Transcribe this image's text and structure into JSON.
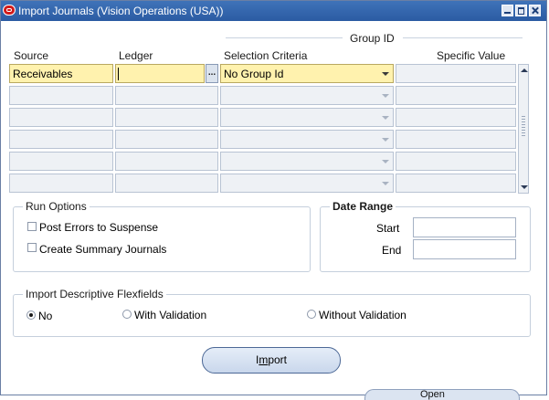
{
  "window": {
    "title": "Import Journals (Vision Operations (USA))"
  },
  "columns": {
    "source": "Source",
    "ledger": "Ledger",
    "group_id": "Group ID",
    "selection": "Selection Criteria",
    "specific": "Specific Value"
  },
  "rows": [
    {
      "source": "Receivables",
      "ledger": "",
      "selection": "No Group Id",
      "specific": ""
    },
    {
      "source": "",
      "ledger": "",
      "selection": "",
      "specific": ""
    },
    {
      "source": "",
      "ledger": "",
      "selection": "",
      "specific": ""
    },
    {
      "source": "",
      "ledger": "",
      "selection": "",
      "specific": ""
    },
    {
      "source": "",
      "ledger": "",
      "selection": "",
      "specific": ""
    },
    {
      "source": "",
      "ledger": "",
      "selection": "",
      "specific": ""
    }
  ],
  "lov_button": "...",
  "run_options": {
    "legend": "Run Options",
    "post_errors": "Post Errors to Suspense",
    "create_summary": "Create Summary Journals"
  },
  "date_range": {
    "legend": "Date Range",
    "start_label": "Start",
    "end_label": "End",
    "start_value": "",
    "end_value": ""
  },
  "flexfields": {
    "legend": "Import Descriptive Flexfields",
    "no": "No",
    "with_validation": "With Validation",
    "without_validation": "Without Validation"
  },
  "import_button": {
    "pre": "I",
    "mnemonic": "m",
    "post": "port"
  },
  "open_button": "Open",
  "colors": {
    "titlebar": "#2b5ba3",
    "active_field": "#fff2ae",
    "inactive_field": "#eef1f5"
  }
}
